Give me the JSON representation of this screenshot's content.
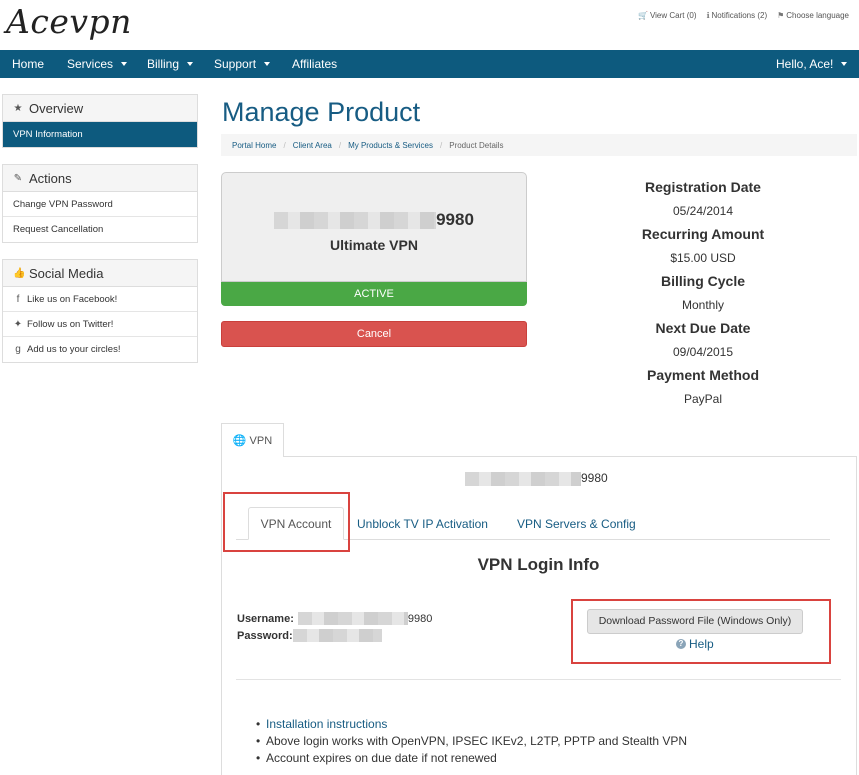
{
  "logo": "Acevpn",
  "top_links": [
    {
      "icon": "cart-icon",
      "glyph": "🛒",
      "label": "View Cart (0)"
    },
    {
      "icon": "info-icon",
      "glyph": "ℹ",
      "label": "Notifications (2)"
    },
    {
      "icon": "language-icon",
      "glyph": "⚑",
      "label": "Choose language"
    }
  ],
  "nav": {
    "home": "Home",
    "services": "Services",
    "billing": "Billing",
    "support": "Support",
    "affiliates": "Affiliates",
    "user": "Hello, Ace!"
  },
  "sidebar": {
    "overview": {
      "title": "Overview",
      "items": [
        "VPN Information"
      ]
    },
    "actions": {
      "title": "Actions",
      "items": [
        "Change VPN Password",
        "Request Cancellation"
      ]
    },
    "social": {
      "title": "Social Media",
      "items": [
        "Like us on Facebook!",
        "Follow us on Twitter!",
        "Add us to your circles!"
      ]
    }
  },
  "page_title": "Manage Product",
  "breadcrumb": [
    "Portal Home",
    "Client Area",
    "My Products & Services",
    "Product Details"
  ],
  "product": {
    "number_suffix": "9980",
    "name": "Ultimate VPN",
    "status": "ACTIVE",
    "cancel_label": "Cancel"
  },
  "info": {
    "registration_label": "Registration Date",
    "registration_value": "05/24/2014",
    "recurring_label": "Recurring Amount",
    "recurring_value": "$15.00 USD",
    "cycle_label": "Billing Cycle",
    "cycle_value": "Monthly",
    "due_label": "Next Due Date",
    "due_value": "09/04/2015",
    "payment_label": "Payment Method",
    "payment_value": "PayPal"
  },
  "tabs": {
    "outer": "VPN",
    "account_suffix": "9980",
    "inner": [
      "VPN Account",
      "Unblock TV IP Activation",
      "VPN Servers & Config"
    ]
  },
  "login": {
    "title": "VPN Login Info",
    "username_label": "Username:",
    "username_suffix": "9980",
    "password_label": "Password:",
    "download_label": "Download Password File (Windows Only)",
    "help_label": "Help"
  },
  "bullets": {
    "link": "Installation instructions",
    "line2": "Above login works with OpenVPN, IPSEC IKEv2, L2TP, PPTP and Stealth VPN",
    "line3": "Account expires on due date if not renewed"
  },
  "colors": {
    "brand": "#0d5a7e",
    "link": "#175c83",
    "active": "#4aa845",
    "danger": "#d9534f",
    "highlight": "#d9433f"
  }
}
